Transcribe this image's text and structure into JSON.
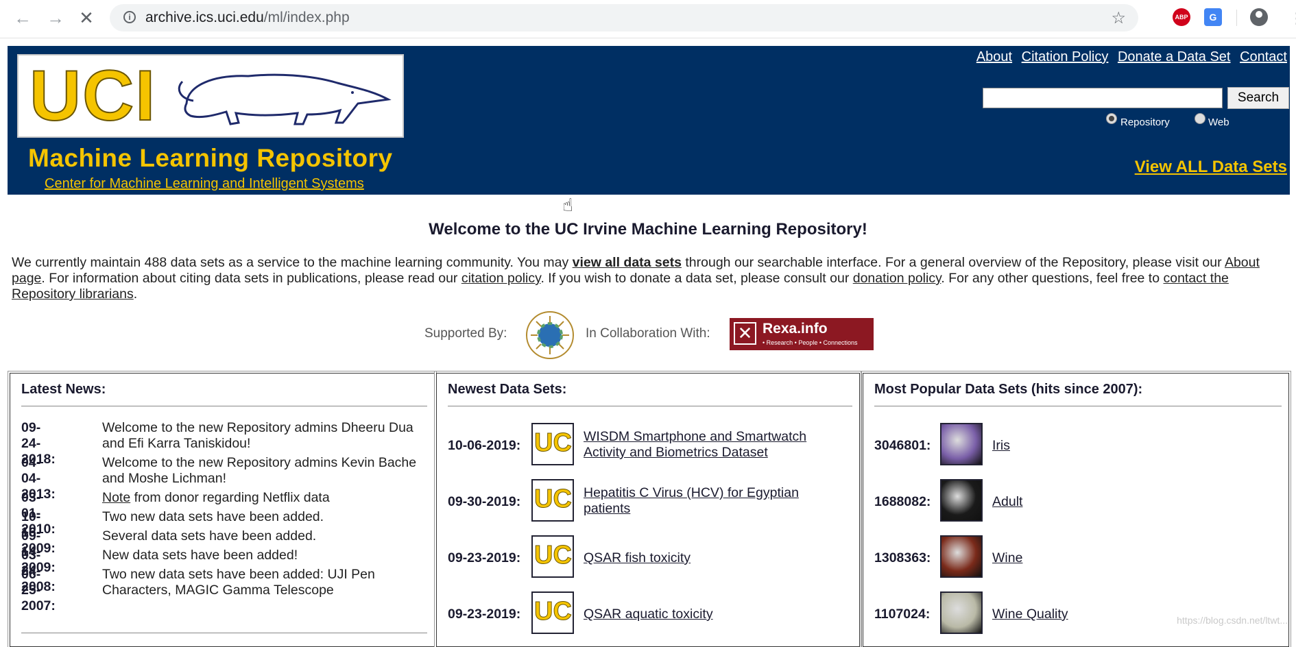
{
  "browser": {
    "url_domain": "archive.ics.uci.edu",
    "url_path": "/ml/index.php",
    "ext_abp": "ABP",
    "ext_translate": "G"
  },
  "header": {
    "logo_text": "UCI",
    "title": "Machine Learning Repository",
    "subtitle_link": "Center for Machine Learning and Intelligent Systems",
    "links": [
      "About",
      "Citation Policy",
      "Donate a Data Set",
      "Contact"
    ],
    "search_button": "Search",
    "search_value": "",
    "radio_repository": "Repository",
    "radio_web": "Web",
    "view_all": "View ALL Data Sets"
  },
  "intro": {
    "welcome": "Welcome to the UC Irvine Machine Learning Repository!",
    "p1": "We currently maintain 488 data sets as a service to the machine learning community. You may ",
    "link_view_all": "view all data sets",
    "p2": " through our searchable interface. For a general overview of the Repository, please visit our ",
    "link_about": "About page",
    "p3": ". For information about citing data sets in publications, please read our ",
    "link_citation": "citation policy",
    "p4": ". If you wish to donate a data set, please consult our ",
    "link_donation": "donation policy",
    "p5": ". For any other questions, feel free to ",
    "link_contact": "contact the Repository librarians",
    "p6": ".",
    "supported_by": "Supported By:",
    "collaboration": "In Collaboration With:",
    "rexa_name": "Rexa.info",
    "rexa_tag": "• Research • People • Connections"
  },
  "news": {
    "title": "Latest News:",
    "items": [
      {
        "date": "09-24-2018:",
        "text": "Welcome to the new Repository admins Dheeru Dua and Efi Karra Taniskidou!"
      },
      {
        "date": "04-04-2013:",
        "text": "Welcome to the new Repository admins Kevin Bache and Moshe Lichman!"
      },
      {
        "date": "03-01-2010:",
        "link": "Note",
        "text": " from donor regarding Netflix data"
      },
      {
        "date": "10-16-2009:",
        "text": "Two new data sets have been added."
      },
      {
        "date": "09-14-2009:",
        "text": "Several data sets have been added."
      },
      {
        "date": "03-24-2008:",
        "text": "New data sets have been added!"
      },
      {
        "date": "06-25-2007:",
        "text": "Two new data sets have been added: UJI Pen Characters, MAGIC Gamma Telescope"
      }
    ]
  },
  "newest": {
    "title": "Newest Data Sets:",
    "items": [
      {
        "date": "10-06-2019:",
        "name": "WISDM Smartphone and Smartwatch Activity and Biometrics Dataset"
      },
      {
        "date": "09-30-2019:",
        "name": "Hepatitis C Virus (HCV) for Egyptian patients"
      },
      {
        "date": "09-23-2019:",
        "name": "QSAR fish toxicity"
      },
      {
        "date": "09-23-2019:",
        "name": "QSAR aquatic toxicity"
      }
    ]
  },
  "popular": {
    "title": "Most Popular Data Sets (hits since 2007):",
    "items": [
      {
        "hits": "3046801:",
        "name": "Iris",
        "color": "#7a5fa8"
      },
      {
        "hits": "1688082:",
        "name": "Adult",
        "color": "#1a1a1a"
      },
      {
        "hits": "1308363:",
        "name": "Wine",
        "color": "#7a2a1a"
      },
      {
        "hits": "1107024:",
        "name": "Wine Quality",
        "color": "#b9b9a6"
      }
    ]
  },
  "watermark": "https://blog.csdn.net/ltwt..."
}
